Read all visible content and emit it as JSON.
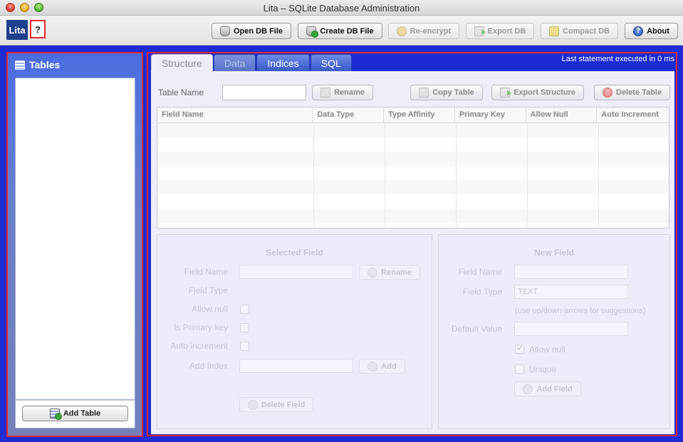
{
  "window": {
    "title": "Lita – SQLite Database Administration"
  },
  "app": {
    "logo": "Lita",
    "help": "?"
  },
  "toolbar": {
    "open_db": "Open DB File",
    "create_db": "Create DB File",
    "reencrypt": "Re-encrypt",
    "export_db": "Export DB",
    "compact_db": "Compact DB",
    "about": "About"
  },
  "sidebar": {
    "title": "Tables",
    "add_table": "Add Table"
  },
  "tabs": [
    {
      "label": "Structure",
      "state": "active"
    },
    {
      "label": "Data",
      "state": "disabled"
    },
    {
      "label": "Indices",
      "state": "normal"
    },
    {
      "label": "SQL",
      "state": "normal"
    }
  ],
  "status": {
    "last_statement": "Last statement executed in 0 ms"
  },
  "structure": {
    "table_name_label": "Table Name",
    "table_name_value": "",
    "rename": "Rename",
    "copy_table": "Copy Table",
    "export_structure": "Export Structure",
    "delete_table": "Delete Table",
    "columns": [
      "Field Name",
      "Data Type",
      "Type Affinity",
      "Primary Key",
      "Allow Null",
      "Auto Increment"
    ]
  },
  "selected_field": {
    "title": "Selected Field",
    "field_name_label": "Field Name",
    "field_type_label": "Field Type",
    "allow_null_label": "Allow null",
    "primary_key_label": "Is Primary key",
    "auto_increment_label": "Auto increment",
    "add_index_label": "Add Index",
    "rename": "Rename",
    "add": "Add",
    "delete_field": "Delete Field"
  },
  "new_field": {
    "title": "New Field",
    "field_name_label": "Field Name",
    "field_type_label": "Field Type",
    "field_type_value": "TEXT",
    "hint": "(use up/down arrows for suggestions)",
    "default_value_label": "Default Value",
    "allow_null_label": "Allow null",
    "unique_label": "Unique",
    "add_field": "Add Field"
  }
}
